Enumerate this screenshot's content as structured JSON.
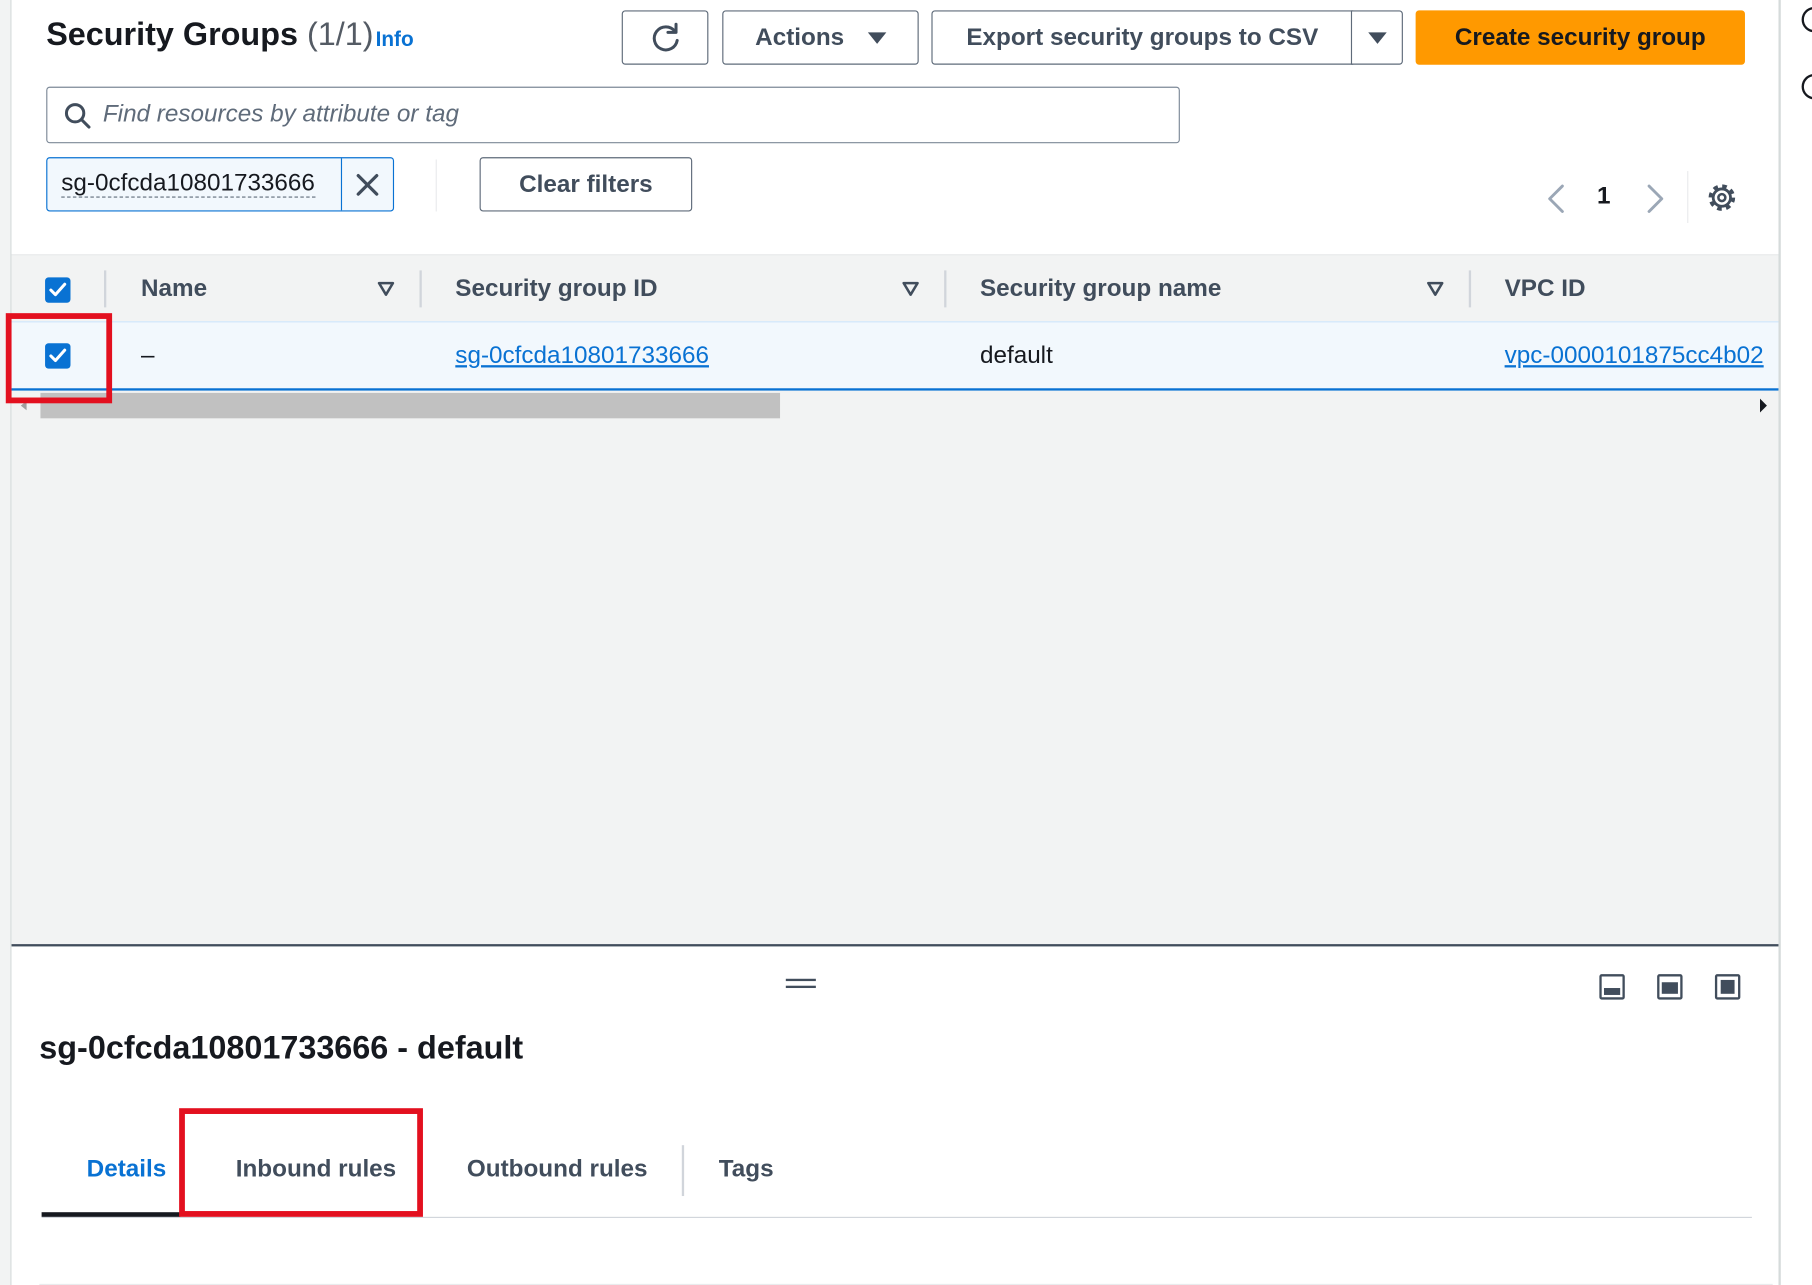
{
  "header": {
    "title": "Security Groups",
    "count": "(1/1)",
    "info_label": "Info",
    "actions_label": "Actions",
    "export_label": "Export security groups to CSV",
    "create_label": "Create security group"
  },
  "search": {
    "placeholder": "Find resources by attribute or tag"
  },
  "filter": {
    "token": "sg-0cfcda10801733666",
    "clear_label": "Clear filters"
  },
  "pagination": {
    "current_page": "1"
  },
  "table": {
    "columns": [
      "Name",
      "Security group ID",
      "Security group name",
      "VPC ID"
    ],
    "rows": [
      {
        "selected": true,
        "name": "–",
        "security_group_id": "sg-0cfcda10801733666",
        "security_group_name": "default",
        "vpc_id": "vpc-0000101875cc4b02"
      }
    ]
  },
  "details": {
    "title": "sg-0cfcda10801733666 - default",
    "tabs": [
      "Details",
      "Inbound rules",
      "Outbound rules",
      "Tags"
    ],
    "active_tab": "Details"
  },
  "colors": {
    "accent": "#0972d3",
    "primary_button": "#ff9900",
    "highlight": "#e3101f"
  },
  "icons": {
    "refresh": "refresh-icon",
    "search": "search-icon",
    "close": "close-icon",
    "settings": "gear-icon",
    "caret": "caret-down-icon",
    "sort": "sort-down-icon"
  }
}
